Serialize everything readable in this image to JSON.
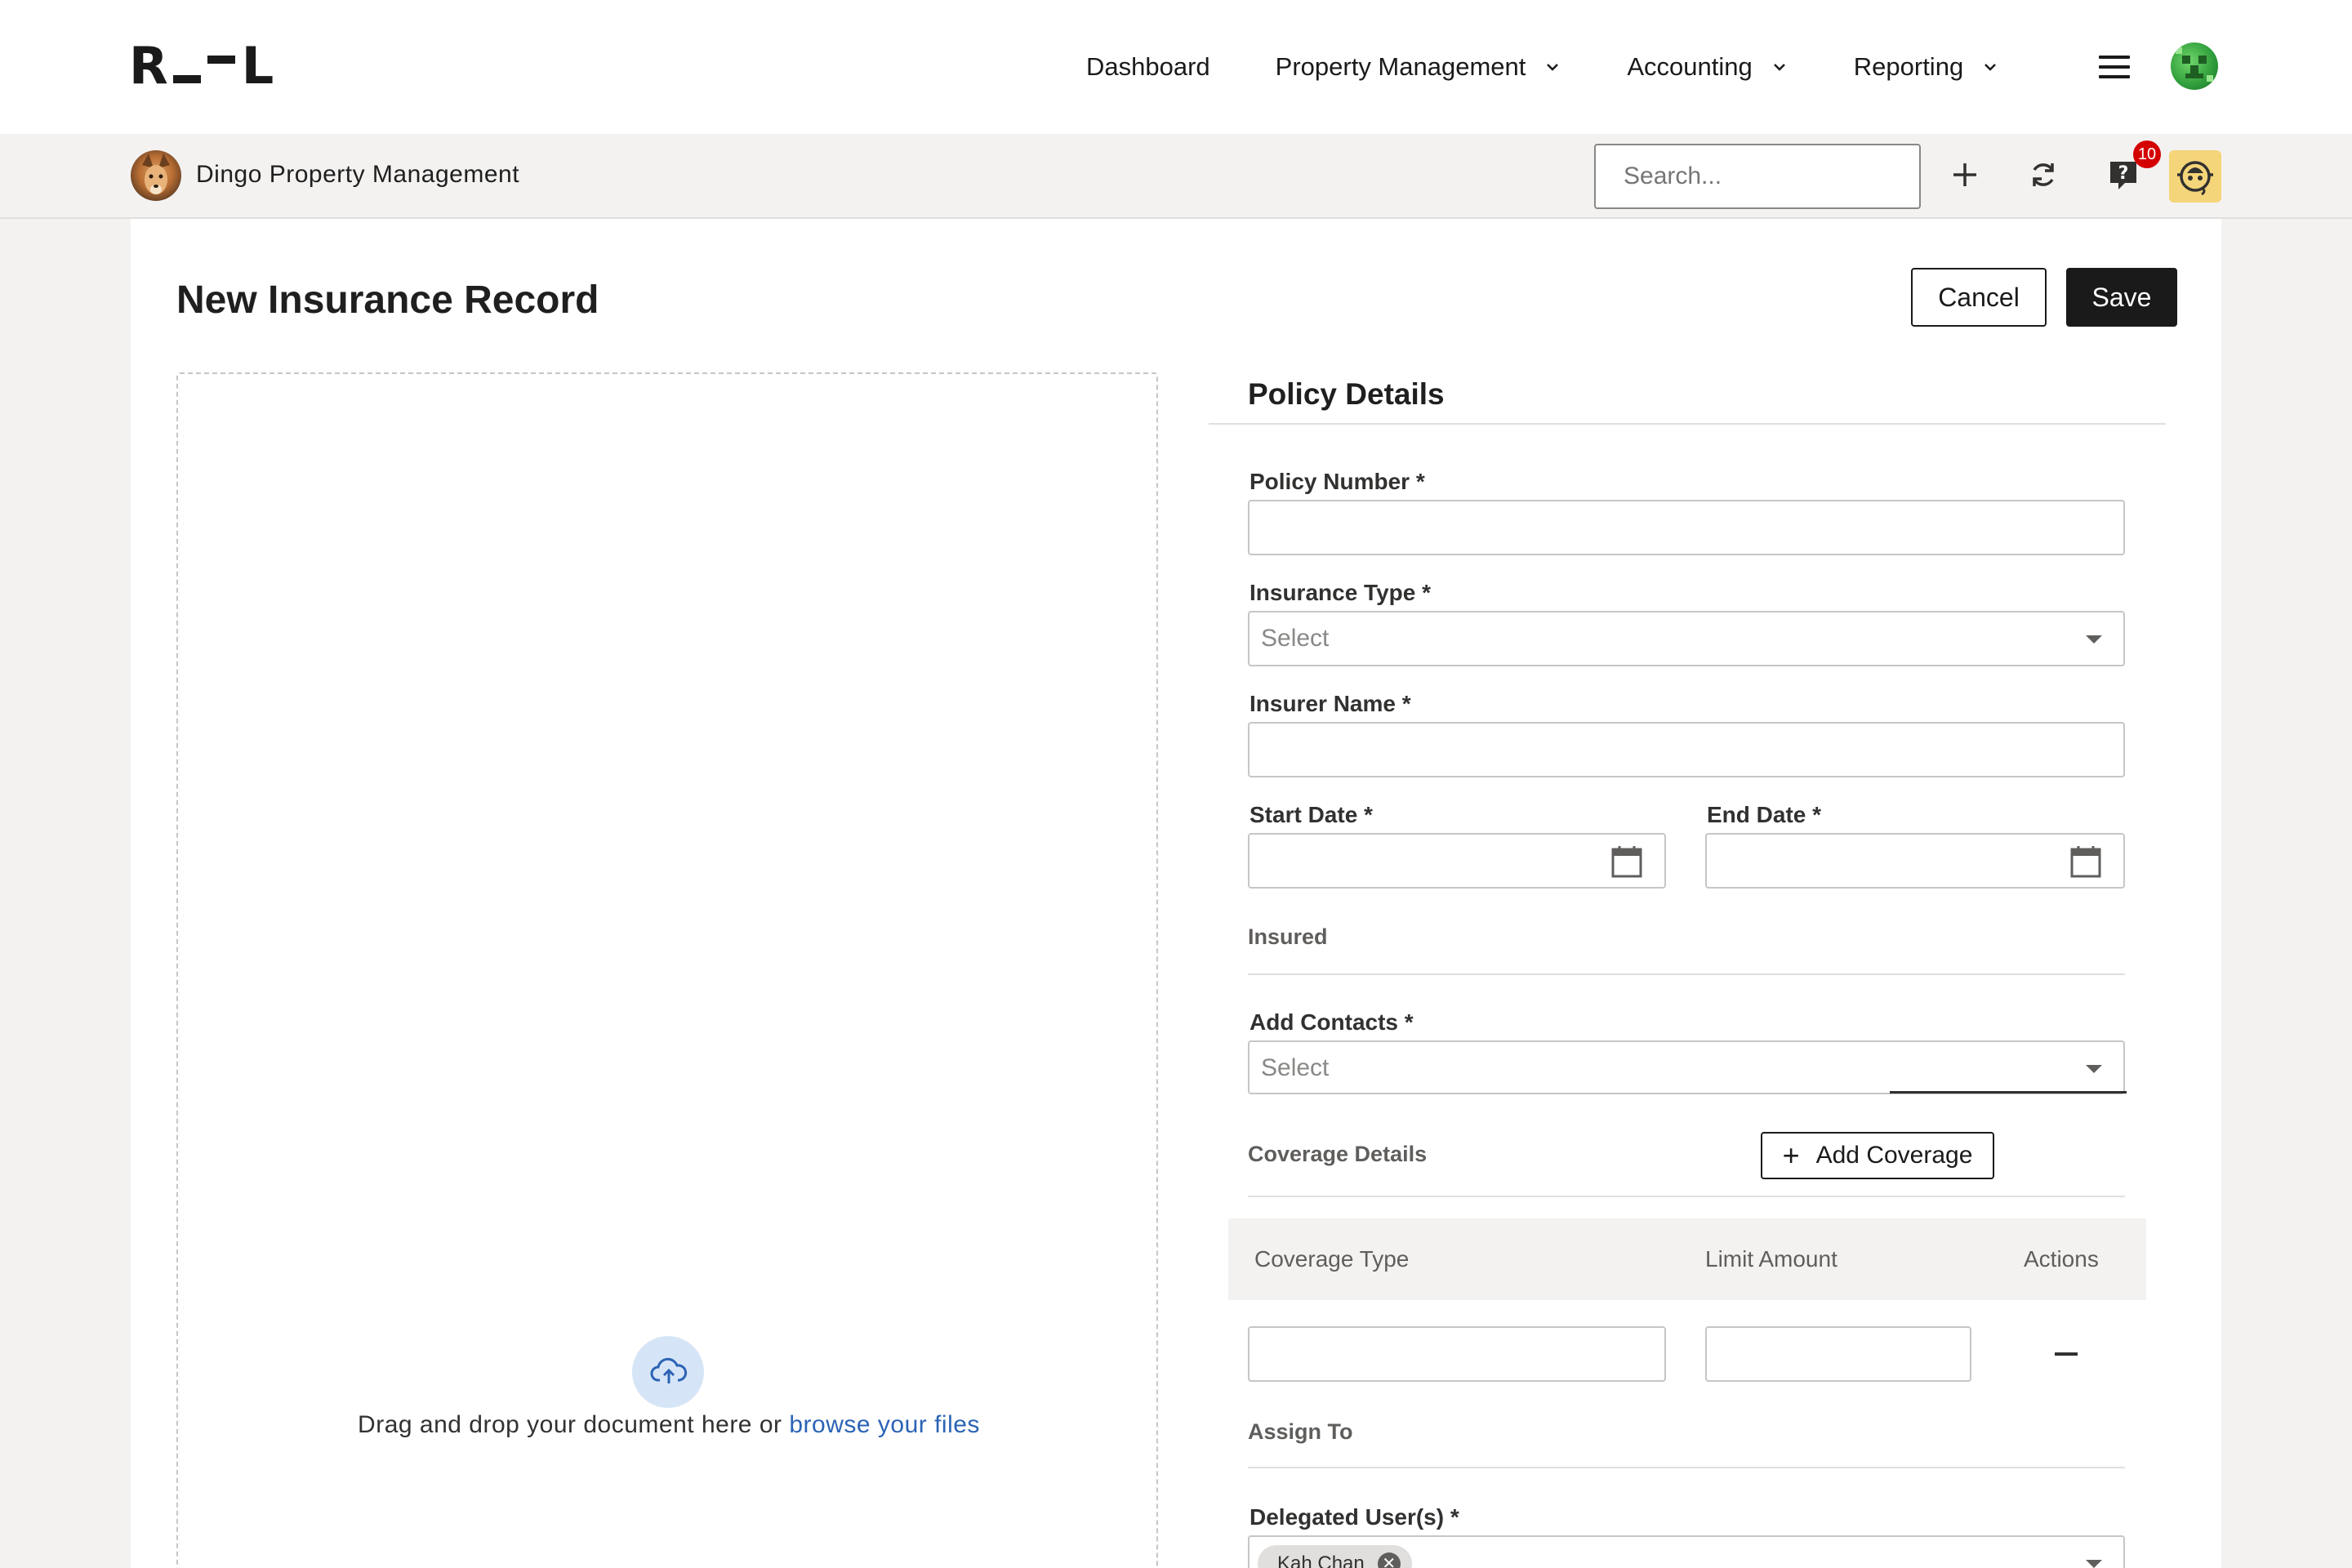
{
  "app": {
    "logo_left": "R",
    "logo_right": "L"
  },
  "nav": {
    "items": [
      {
        "label": "Dashboard",
        "has_dropdown": false
      },
      {
        "label": "Property Management",
        "has_dropdown": true
      },
      {
        "label": "Accounting",
        "has_dropdown": true
      },
      {
        "label": "Reporting",
        "has_dropdown": true
      }
    ],
    "menu_icon": "hamburger-icon",
    "avatar_icon": "user-avatar"
  },
  "subbar": {
    "org_name": "Dingo Property Management",
    "search_placeholder": "Search...",
    "help_badge": "10",
    "icons": [
      "plus-icon",
      "refresh-icon",
      "help-icon",
      "assistant-icon"
    ]
  },
  "page": {
    "title": "New Insurance Record",
    "cancel_label": "Cancel",
    "save_label": "Save"
  },
  "upload": {
    "text": "Drag and drop your document here or ",
    "link": "browse your files",
    "icon": "cloud-upload-icon"
  },
  "form": {
    "section_title": "Policy Details",
    "policy_number": {
      "label": "Policy Number *",
      "value": ""
    },
    "insurance_type": {
      "label": "Insurance Type *",
      "value": "Select"
    },
    "insurer_name": {
      "label": "Insurer Name *",
      "value": ""
    },
    "start_date": {
      "label": "Start Date *",
      "value": ""
    },
    "end_date": {
      "label": "End Date *",
      "value": ""
    },
    "insured_heading": "Insured",
    "add_contacts": {
      "label": "Add Contacts *",
      "value": "Select"
    },
    "coverage_heading": "Coverage Details",
    "add_coverage_label": "Add Coverage",
    "coverage_table": {
      "columns": [
        "Coverage Type",
        "Limit Amount",
        "Actions"
      ],
      "rows": [
        {
          "coverage_type": "",
          "limit_amount": ""
        }
      ]
    },
    "assign_heading": "Assign To",
    "delegated_users": {
      "label": "Delegated User(s) *",
      "chips": [
        "Kah Chan"
      ]
    }
  },
  "colors": {
    "accent_link": "#2b63b5",
    "primary_button": "#1a1a1a",
    "badge": "#d40000",
    "page_bg": "#f3f2f1"
  }
}
